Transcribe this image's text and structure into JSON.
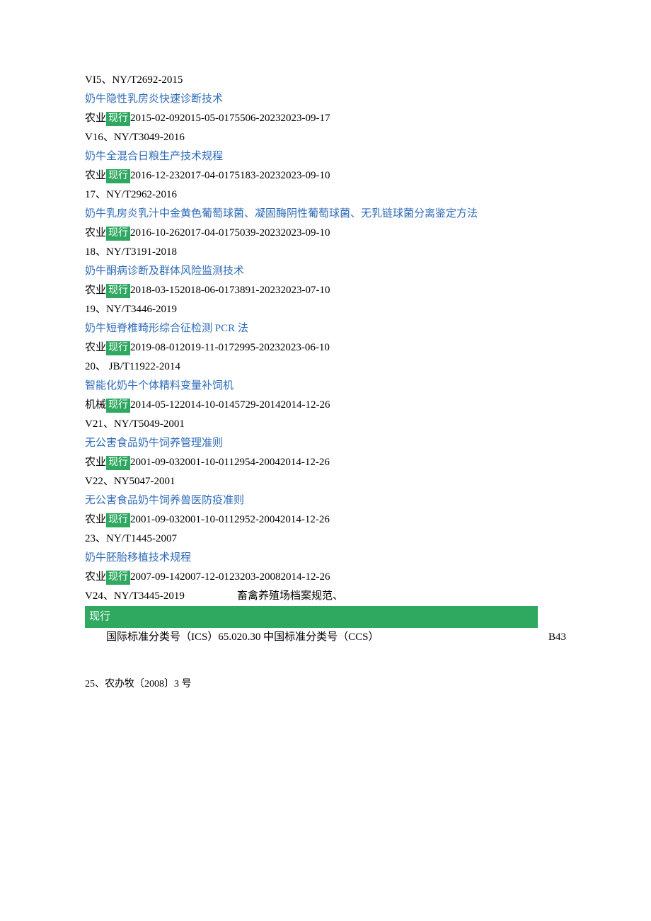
{
  "entries": [
    {
      "code_prefix": "VI5、",
      "code": "NY/T2692-2015",
      "title": "奶牛隐性乳房炎快速诊断技术",
      "dept": "农业",
      "badge": "现行",
      "info": "2015-02-092015-05-0175506-20232023-09-17"
    },
    {
      "code_prefix": "V16、",
      "code": "NY/T3049-2016",
      "title": "奶牛全混合日粮生产技术规程",
      "dept": "农业",
      "badge": "现行",
      "info": "2016-12-232017-04-0175183-20232023-09-10"
    },
    {
      "code_prefix": "17、",
      "code": "NY/T2962-2016",
      "title": "奶牛乳房炎乳汁中金黄色葡萄球菌、凝固酶阴性葡萄球菌、无乳链球菌分离鉴定方法",
      "dept": "农业",
      "badge": "现行",
      "info": "2016-10-262017-04-0175039-20232023-09-10",
      "wrap": true
    },
    {
      "code_prefix": "18、",
      "code": "NY/T3191-2018",
      "title": "奶牛酮病诊断及群体风险监测技术",
      "dept": "农业",
      "badge": "现行",
      "info": "2018-03-152018-06-0173891-20232023-07-10"
    },
    {
      "code_prefix": "19、",
      "code": "NY/T3446-2019",
      "title": "奶牛短脊椎畸形综合征检测 PCR 法",
      "dept": "农业",
      "badge": "现行",
      "info": "2019-08-012019-11-0172995-20232023-06-10"
    },
    {
      "code_prefix": "20、 ",
      "code": "JB/T11922-2014",
      "title": "智能化奶牛个体精料变量补饲机",
      "dept": "机械",
      "badge": "现行",
      "info": "2014-05-122014-10-0145729-20142014-12-26"
    },
    {
      "code_prefix": "V21、",
      "code": "NY/T5049-2001",
      "title": "无公害食品奶牛饲养管理准则",
      "dept": "农业",
      "badge": "现行",
      "info": "2001-09-032001-10-0112954-20042014-12-26"
    },
    {
      "code_prefix": "V22、",
      "code": "NY5047-2001",
      "title": "无公害食品奶牛饲养兽医防疫准则",
      "dept": "农业",
      "badge": "现行",
      "info": "2001-09-032001-10-0112952-20042014-12-26"
    },
    {
      "code_prefix": "23、",
      "code": "NY/T1445-2007",
      "title": "奶牛胚胎移植技术规程",
      "dept": "农业",
      "badge": "现行",
      "info": "2007-09-142007-12-0123203-20082014-12-26"
    }
  ],
  "special": {
    "code_prefix": "V24、",
    "code": "NY/T3445-2019",
    "extra": "畜禽养殖场档案规范、",
    "badge": "现行",
    "ics_label": "国际标准分类号（ICS）65.020.30 中国标准分类号（CCS）",
    "ccs": "B43"
  },
  "footnote": "25、农办牧〔2008〕3 号"
}
